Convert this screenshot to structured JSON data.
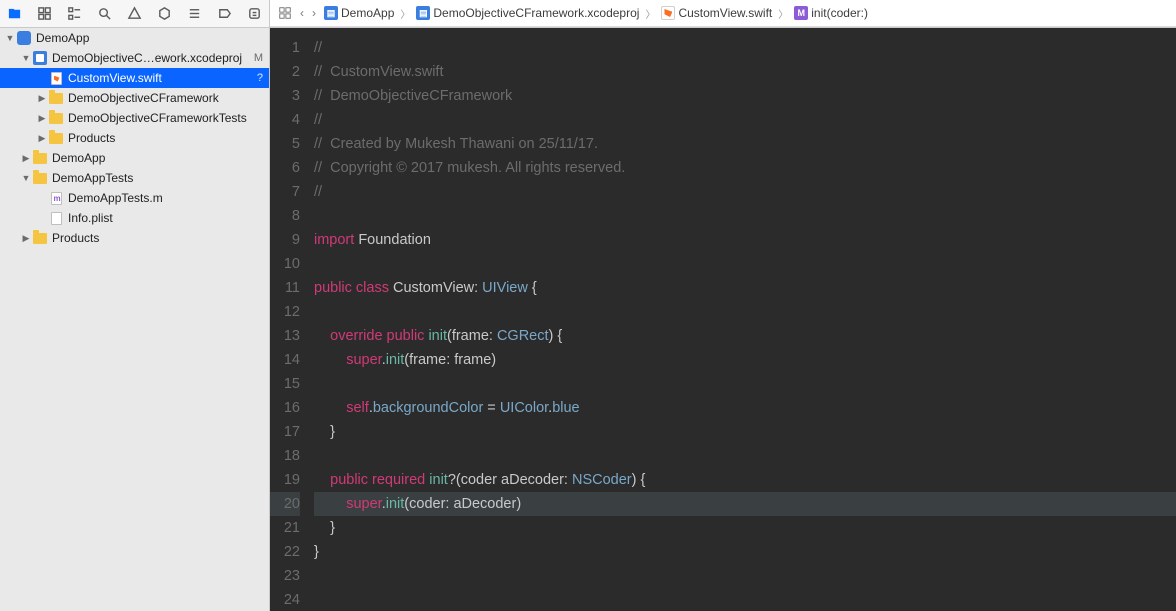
{
  "breadcrumb": {
    "items": [
      "DemoApp",
      "DemoObjectiveCFramework.xcodeproj",
      "CustomView.swift",
      "init(coder:)"
    ]
  },
  "sidebar": {
    "root": "DemoApp",
    "proj_name": "DemoObjectiveC…ework.xcodeproj",
    "proj_badge": "M",
    "sel_file": "CustomView.swift",
    "sel_badge": "?",
    "folders_l2": [
      "DemoObjectiveCFramework",
      "DemoObjectiveCFrameworkTests",
      "Products"
    ],
    "folders_l1_a": "DemoApp",
    "tests_folder": "DemoAppTests",
    "tests_children": [
      "DemoAppTests.m",
      "Info.plist"
    ],
    "folders_l1_b": "Products"
  },
  "code": {
    "lines": [
      {
        "n": 1,
        "t": "comment",
        "txt": "//"
      },
      {
        "n": 2,
        "t": "comment",
        "txt": "//  CustomView.swift"
      },
      {
        "n": 3,
        "t": "comment",
        "txt": "//  DemoObjectiveCFramework"
      },
      {
        "n": 4,
        "t": "comment",
        "txt": "//"
      },
      {
        "n": 5,
        "t": "comment",
        "txt": "//  Created by Mukesh Thawani on 25/11/17."
      },
      {
        "n": 6,
        "t": "comment",
        "txt": "//  Copyright © 2017 mukesh. All rights reserved."
      },
      {
        "n": 7,
        "t": "comment",
        "txt": "//"
      },
      {
        "n": 8,
        "t": "blank",
        "txt": ""
      },
      {
        "n": 9,
        "t": "import",
        "kw": "import",
        "rest": " Foundation"
      },
      {
        "n": 10,
        "t": "blank",
        "txt": ""
      },
      {
        "n": 11,
        "t": "class",
        "pre": "public class ",
        "name": "CustomView",
        "post": ": ",
        "sup": "UIView",
        "brace": " {"
      },
      {
        "n": 12,
        "t": "blank",
        "txt": ""
      },
      {
        "n": 13,
        "t": "initframe",
        "indent": "    ",
        "mods": "override public ",
        "kw": "init",
        "sig": "(frame: ",
        "ptype": "CGRect",
        "end": ") {"
      },
      {
        "n": 14,
        "t": "superframe",
        "indent": "        ",
        "sup": "super",
        "dot": ".",
        "fn": "init",
        "args": "(frame: frame)"
      },
      {
        "n": 15,
        "t": "blank",
        "txt": ""
      },
      {
        "n": 16,
        "t": "bg",
        "indent": "        ",
        "slf": "self",
        "dot": ".",
        "prop": "backgroundColor",
        "eq": " = ",
        "cls": "UIColor",
        "dot2": ".",
        "val": "blue"
      },
      {
        "n": 17,
        "t": "close",
        "indent": "    ",
        "txt": "}"
      },
      {
        "n": 18,
        "t": "blank",
        "txt": ""
      },
      {
        "n": 19,
        "t": "initcoder",
        "indent": "    ",
        "mods": "public required ",
        "kw": "init",
        "opt": "?",
        "sig": "(coder aDecoder: ",
        "ptype": "NSCoder",
        "end": ") {"
      },
      {
        "n": 20,
        "t": "supercoder",
        "indent": "        ",
        "sup": "super",
        "dot": ".",
        "fn": "init",
        "args": "(coder: aDecoder)",
        "hl": true
      },
      {
        "n": 21,
        "t": "close",
        "indent": "    ",
        "txt": "}"
      },
      {
        "n": 22,
        "t": "close",
        "indent": "",
        "txt": "}"
      },
      {
        "n": 23,
        "t": "blank",
        "txt": ""
      },
      {
        "n": 24,
        "t": "blank",
        "txt": ""
      }
    ],
    "highlight_line": 20
  }
}
